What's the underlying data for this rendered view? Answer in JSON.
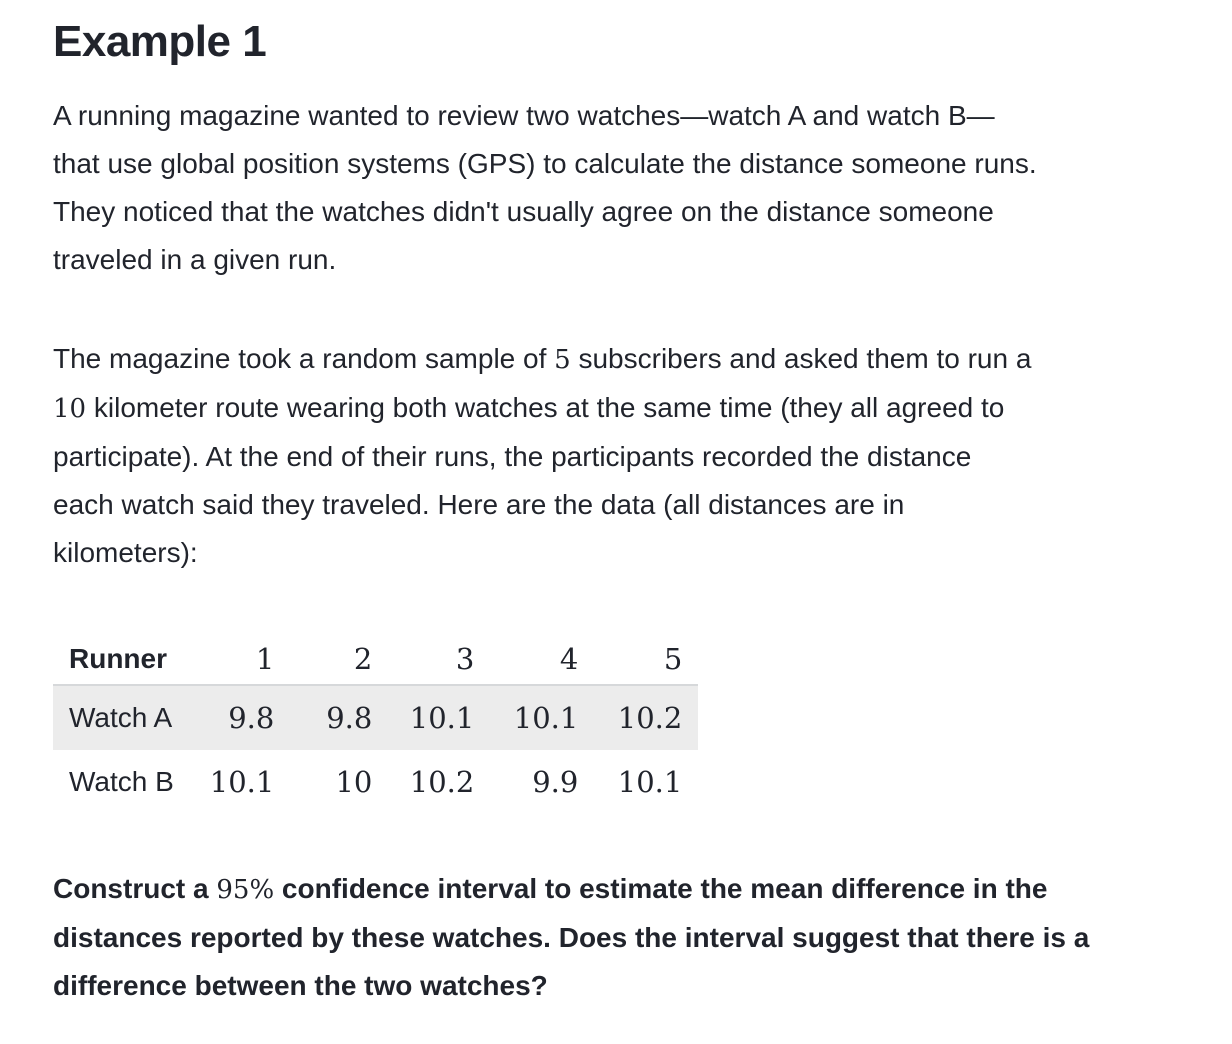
{
  "title": "Example 1",
  "intro": {
    "lines": [
      "A running magazine wanted to review two watches—watch A and watch B—",
      "that use global position systems (GPS) to calculate the distance someone runs.",
      "They noticed that the watches didn't usually agree on the distance someone",
      "traveled in a given run."
    ]
  },
  "sampling": {
    "line1_pre": "The magazine took a random sample of ",
    "sample_size": "5",
    "line1_post": " subscribers and asked them to run a",
    "route_length": "10",
    "line2_post": " kilometer route wearing both watches at the same time (they all agreed to",
    "lines_rest": [
      "participate). At the end of their runs, the participants recorded the distance",
      "each watch said they traveled. Here are the data (all distances are in",
      "kilometers):"
    ]
  },
  "table": {
    "header_label": "Runner",
    "runners": [
      "1",
      "2",
      "3",
      "4",
      "5"
    ],
    "rows": [
      {
        "label": "Watch A",
        "values": [
          "9.8",
          "9.8",
          "10.1",
          "10.1",
          "10.2"
        ]
      },
      {
        "label": "Watch B",
        "values": [
          "10.1",
          "10",
          "10.2",
          "9.9",
          "10.1"
        ]
      }
    ]
  },
  "question": {
    "line1_pre": "Construct a ",
    "confidence": "95%",
    "line1_post": " confidence interval to estimate the mean difference in the",
    "lines_rest": [
      "distances reported by these watches. Does the interval suggest that there is a",
      "difference between the two watches?"
    ]
  }
}
